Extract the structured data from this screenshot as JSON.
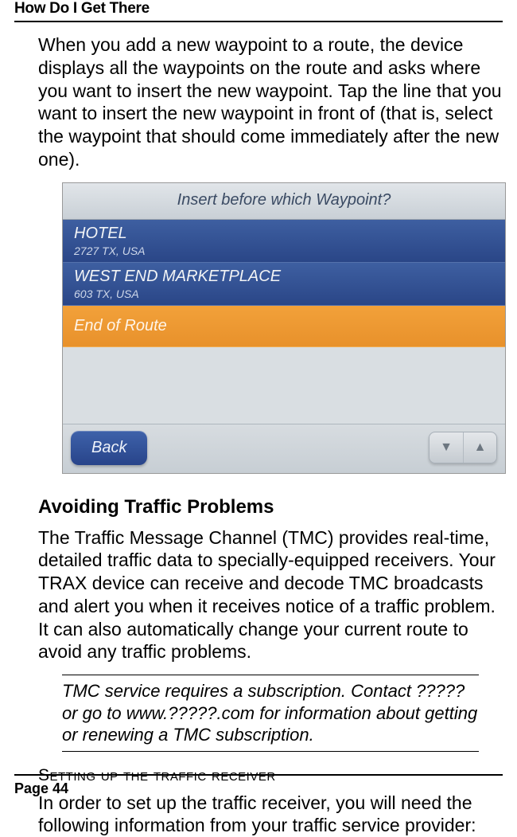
{
  "header": "How Do I Get There",
  "paragraphs": {
    "intro": "When you add a new waypoint to a route, the device displays all the waypoints on the route and asks where you want to insert the new waypoint. Tap the line that you want to insert the new waypoint in front of (that is, select the waypoint that should come immediately after the new one).",
    "traffic_body": "The Traffic Message Channel (TMC) provides real-time, detailed traffic data to specially-equipped receivers. Your TRAX device can receive and decode TMC broadcasts and alert you when it receives notice of a traffic problem. It can also automatically change your current route to avoid any traffic problems.",
    "receiver_body": "In order to set up the traffic receiver, you will need the following information from your traffic service provider:"
  },
  "headings": {
    "traffic": "Avoiding Traffic Problems",
    "receiver_sub": "Setting up the traffic receiver"
  },
  "note": "TMC service requires a subscription. Contact ????? or go to www.?????.com for information about getting or renewing a TMC subscription.",
  "footer": "Page 44",
  "device": {
    "title": "Insert before which Waypoint?",
    "rows": [
      {
        "main": "HOTEL",
        "sub": "2727 TX, USA"
      },
      {
        "main": "WEST END MARKETPLACE",
        "sub": "603 TX, USA"
      }
    ],
    "end_label": "End of Route",
    "back_label": "Back",
    "icons": {
      "down": "▼",
      "up": "▲"
    }
  }
}
